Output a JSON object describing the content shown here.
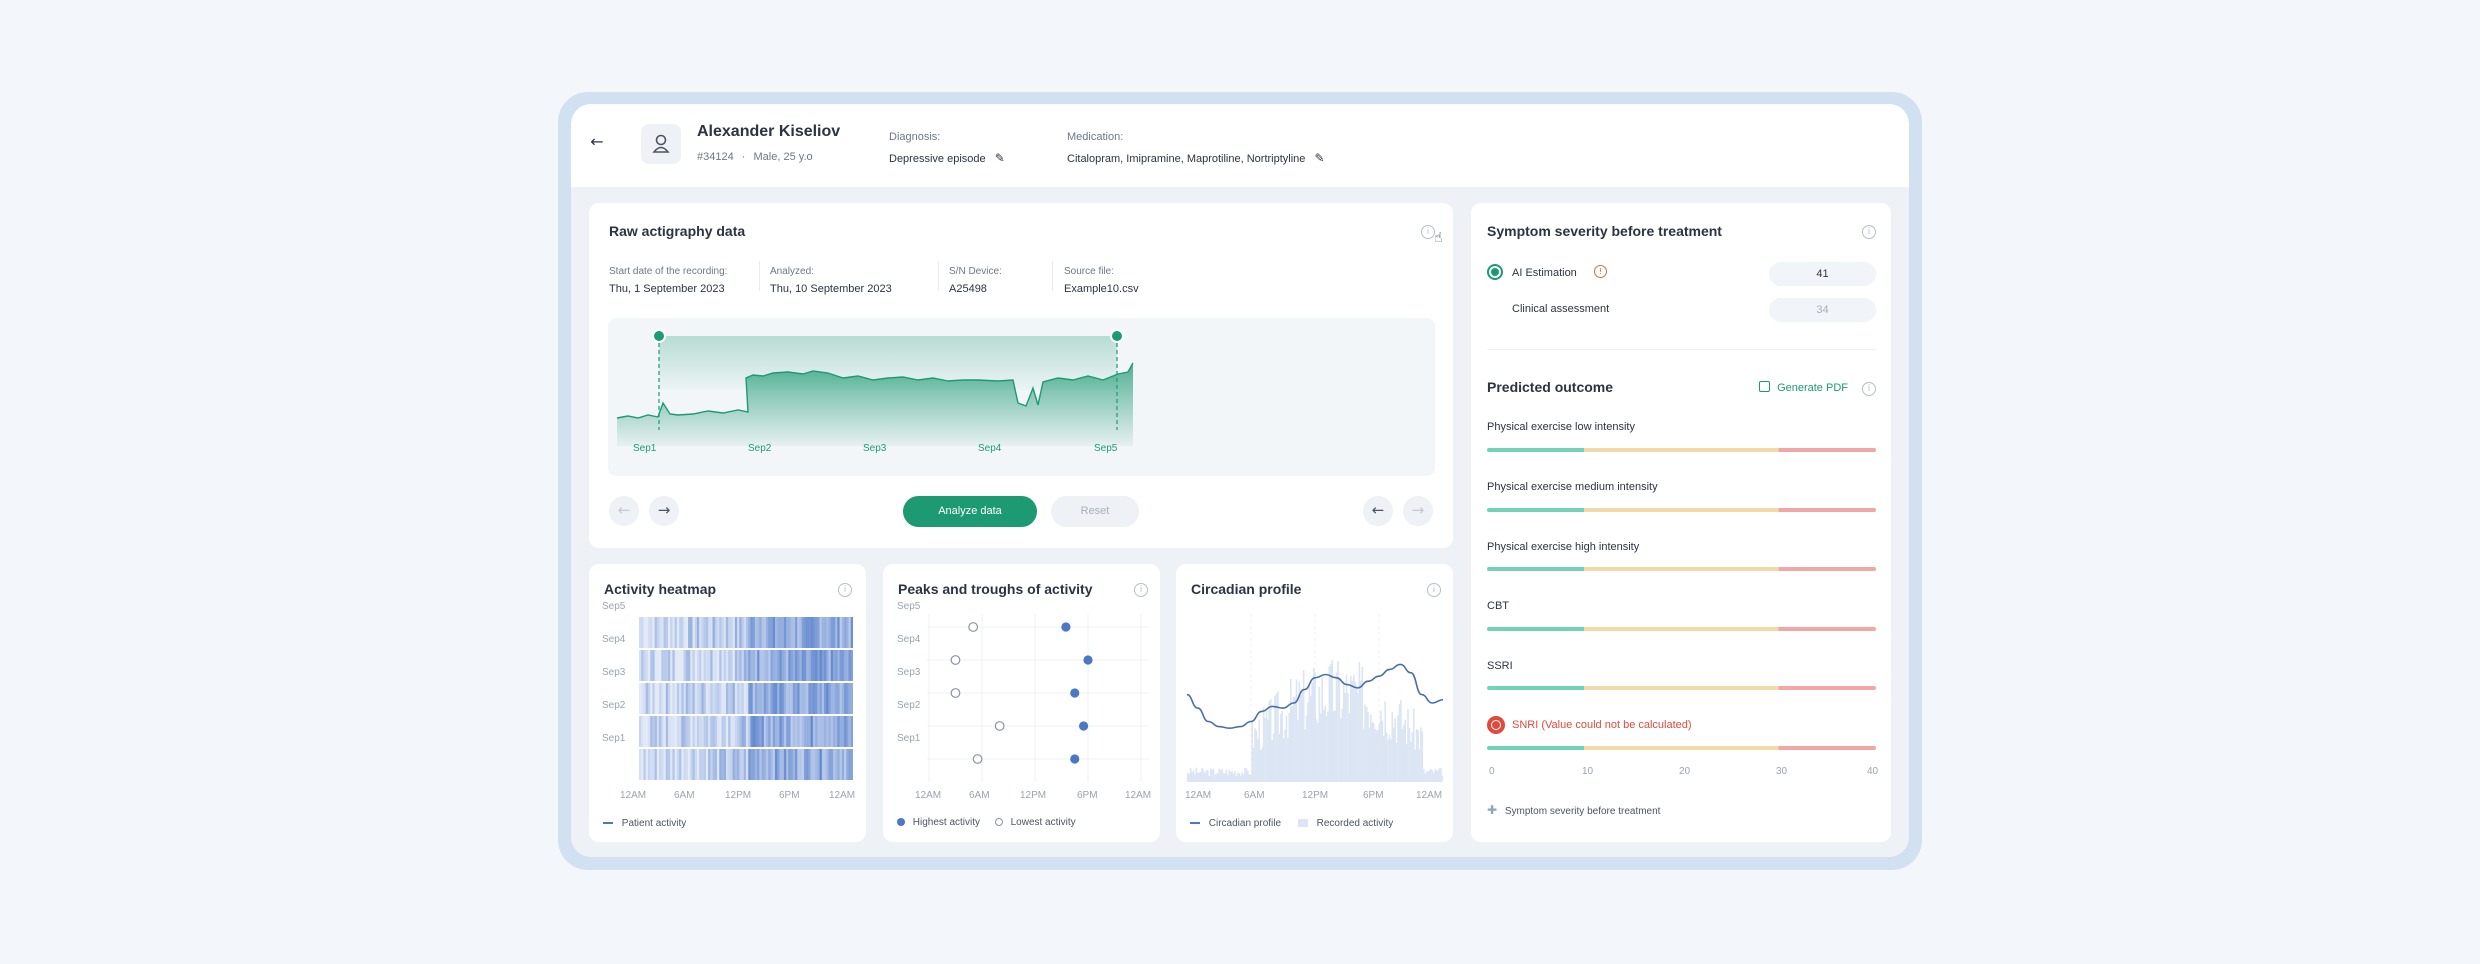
{
  "patient": {
    "name": "Alexander Kiseliov",
    "id": "#34124",
    "separator": "·",
    "demographics": "Male, 25 y.o",
    "diagnosis_label": "Diagnosis:",
    "diagnosis": "Depressive episode",
    "medication_label": "Medication:",
    "medication": "Citalopram, Imipramine, Maprotiline, Nortriptyline"
  },
  "raw": {
    "title": "Raw actigraphy data",
    "meta": [
      {
        "label": "Start date of the recording:",
        "value": "Thu, 1 September 2023"
      },
      {
        "label": "Analyzed:",
        "value": "Thu, 10 September 2023"
      },
      {
        "label": "S/N Device:",
        "value": "A25498"
      },
      {
        "label": "Source file:",
        "value": "Example10.csv"
      }
    ],
    "x_labels": [
      "Sep1",
      "Sep2",
      "Sep3",
      "Sep4",
      "Sep5"
    ],
    "analyze_label": "Analyze data",
    "reset_label": "Reset"
  },
  "heatmap": {
    "title": "Activity heatmap",
    "rows": [
      "Sep5",
      "Sep4",
      "Sep3",
      "Sep2",
      "Sep1"
    ],
    "x_labels": [
      "12AM",
      "6AM",
      "12PM",
      "6PM",
      "12AM"
    ],
    "legend": "Patient activity"
  },
  "peaks": {
    "title": "Peaks and troughs of activity",
    "rows": [
      "Sep5",
      "Sep4",
      "Sep3",
      "Sep2",
      "Sep1"
    ],
    "x_labels": [
      "12AM",
      "6AM",
      "12PM",
      "6PM",
      "12AM"
    ],
    "legend_high": "Highest activity",
    "legend_low": "Lowest activity"
  },
  "circadian": {
    "title": "Circadian profile",
    "x_labels": [
      "12AM",
      "6AM",
      "12PM",
      "6PM",
      "12AM"
    ],
    "legend_profile": "Circadian profile",
    "legend_recorded": "Recorded activity"
  },
  "severity": {
    "title": "Symptom severity before treatment",
    "ai_label": "AI Estimation",
    "ai_value": "41",
    "clinical_label": "Clinical assessment",
    "clinical_value": "34"
  },
  "outcome": {
    "title": "Predicted outcome",
    "pdf_label": "Generate PDF",
    "items": [
      "Physical exercise low intensity",
      "Physical exercise medium intensity",
      "Physical exercise high intensity",
      "CBT",
      "SSRI"
    ],
    "error_item": "SNRI (Value could not be calculated)",
    "scale": [
      "0",
      "10",
      "20",
      "30",
      "40"
    ],
    "legend": "Symptom severity before treatment"
  },
  "colors": {
    "accent": "#1d9a72",
    "blue": "#4a78c2",
    "error": "#e04a3c"
  },
  "chart_data": [
    {
      "type": "heatmap",
      "title": "Activity heatmap",
      "rows": [
        "Sep5",
        "Sep4",
        "Sep3",
        "Sep2",
        "Sep1"
      ],
      "x_ticks": [
        "12AM",
        "6AM",
        "12PM",
        "6PM",
        "12AM"
      ]
    },
    {
      "type": "scatter",
      "title": "Peaks and troughs of activity",
      "categories": [
        "Sep5",
        "Sep4",
        "Sep3",
        "Sep2",
        "Sep1"
      ],
      "x_ticks": [
        "12AM",
        "6AM",
        "12PM",
        "6PM",
        "12AM"
      ],
      "xlim": [
        0,
        24
      ],
      "series": [
        {
          "name": "Highest activity",
          "values": [
            15.5,
            18,
            16.5,
            17.5,
            16.5
          ]
        },
        {
          "name": "Lowest activity",
          "values": [
            5,
            3,
            3,
            8,
            5.5
          ]
        }
      ]
    },
    {
      "type": "line",
      "title": "Circadian profile",
      "x_ticks": [
        "12AM",
        "6AM",
        "12PM",
        "6PM",
        "12AM"
      ],
      "x": [
        0,
        1,
        2,
        3,
        4,
        5,
        6,
        7,
        8,
        9,
        10,
        11,
        12,
        13,
        14,
        15,
        16,
        17,
        18,
        19,
        20,
        21,
        22,
        23,
        24
      ],
      "series": [
        {
          "name": "Circadian profile",
          "values": [
            0.52,
            0.44,
            0.36,
            0.33,
            0.32,
            0.33,
            0.36,
            0.42,
            0.45,
            0.44,
            0.47,
            0.55,
            0.62,
            0.64,
            0.62,
            0.58,
            0.56,
            0.6,
            0.63,
            0.67,
            0.7,
            0.65,
            0.52,
            0.47,
            0.49
          ]
        }
      ]
    },
    {
      "type": "line",
      "title": "Raw actigraphy data",
      "categories": [
        "Sep1",
        "Sep2",
        "Sep3",
        "Sep4",
        "Sep5"
      ]
    }
  ]
}
